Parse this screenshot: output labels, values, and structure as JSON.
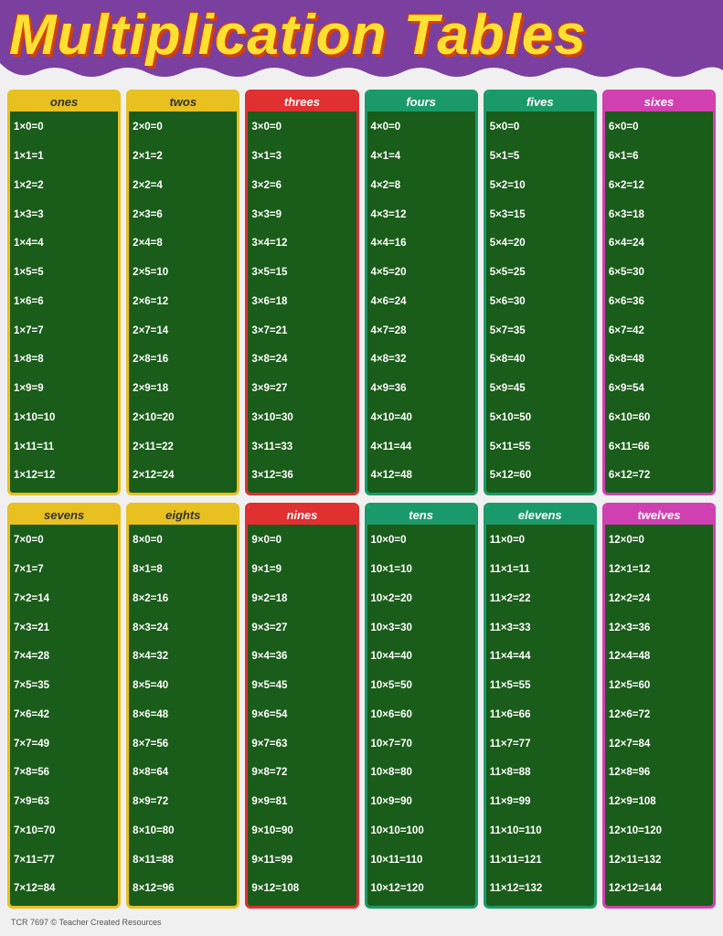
{
  "header": {
    "title": "Multiplication Tables"
  },
  "footer": "TCR 7697  © Teacher Created Resources",
  "tables": [
    {
      "id": "ones",
      "label": "ones",
      "cardClass": "card-ones",
      "multiplier": 1,
      "rows": [
        "1x0=0",
        "1x1=1",
        "1x2=2",
        "1x3=3",
        "1x4=4",
        "1x5=5",
        "1x6=6",
        "1x7=7",
        "1x8=8",
        "1x9=9",
        "1x10=10",
        "1x11=11",
        "1x12=12"
      ]
    },
    {
      "id": "twos",
      "label": "twos",
      "cardClass": "card-twos",
      "multiplier": 2,
      "rows": [
        "2x0=0",
        "2x1=2",
        "2x2=4",
        "2x3=6",
        "2x4=8",
        "2x5=10",
        "2x6=12",
        "2x7=14",
        "2x8=16",
        "2x9=18",
        "2x10=20",
        "2x11=22",
        "2x12=24"
      ]
    },
    {
      "id": "threes",
      "label": "threes",
      "cardClass": "card-threes",
      "multiplier": 3,
      "rows": [
        "3x0=0",
        "3x1=3",
        "3x2=6",
        "3x3=9",
        "3x4=12",
        "3x5=15",
        "3x6=18",
        "3x7=21",
        "3x8=24",
        "3x9=27",
        "3x10=30",
        "3x11=33",
        "3x12=36"
      ]
    },
    {
      "id": "fours",
      "label": "fours",
      "cardClass": "card-fours",
      "multiplier": 4,
      "rows": [
        "4x0=0",
        "4x1=4",
        "4x2=8",
        "4x3=12",
        "4x4=16",
        "4x5=20",
        "4x6=24",
        "4x7=28",
        "4x8=32",
        "4x9=36",
        "4x10=40",
        "4x11=44",
        "4x12=48"
      ]
    },
    {
      "id": "fives",
      "label": "fives",
      "cardClass": "card-fives",
      "multiplier": 5,
      "rows": [
        "5x0=0",
        "5x1=5",
        "5x2=10",
        "5x3=15",
        "5x4=20",
        "5x5=25",
        "5x6=30",
        "5x7=35",
        "5x8=40",
        "5x9=45",
        "5x10=50",
        "5x11=55",
        "5x12=60"
      ]
    },
    {
      "id": "sixes",
      "label": "sixes",
      "cardClass": "card-sixes",
      "multiplier": 6,
      "rows": [
        "6x0=0",
        "6x1=6",
        "6x2=12",
        "6x3=18",
        "6x4=24",
        "6x5=30",
        "6x6=36",
        "6x7=42",
        "6x8=48",
        "6x9=54",
        "6x10=60",
        "6x11=66",
        "6x12=72"
      ]
    },
    {
      "id": "sevens",
      "label": "sevens",
      "cardClass": "card-sevens",
      "multiplier": 7,
      "rows": [
        "7x0=0",
        "7x1=7",
        "7x2=14",
        "7x3=21",
        "7x4=28",
        "7x5=35",
        "7x6=42",
        "7x7=49",
        "7x8=56",
        "7x9=63",
        "7x10=70",
        "7x11=77",
        "7x12=84"
      ]
    },
    {
      "id": "eights",
      "label": "eights",
      "cardClass": "card-eights",
      "multiplier": 8,
      "rows": [
        "8x0=0",
        "8x1=8",
        "8x2=16",
        "8x3=24",
        "8x4=32",
        "8x5=40",
        "8x6=48",
        "8x7=56",
        "8x8=64",
        "8x9=72",
        "8x10=80",
        "8x11=88",
        "8x12=96"
      ]
    },
    {
      "id": "nines",
      "label": "nines",
      "cardClass": "card-nines",
      "multiplier": 9,
      "rows": [
        "9x0=0",
        "9x1=9",
        "9x2=18",
        "9x3=27",
        "9x4=36",
        "9x5=45",
        "9x6=54",
        "9x7=63",
        "9x8=72",
        "9x9=81",
        "9x10=90",
        "9x11=99",
        "9x12=108"
      ]
    },
    {
      "id": "tens",
      "label": "tens",
      "cardClass": "card-tens",
      "multiplier": 10,
      "rows": [
        "10x0=0",
        "10x1=10",
        "10x2=20",
        "10x3=30",
        "10x4=40",
        "10x5=50",
        "10x6=60",
        "10x7=70",
        "10x8=80",
        "10x9=90",
        "10x10=100",
        "10x11=110",
        "10x12=120"
      ]
    },
    {
      "id": "elevens",
      "label": "elevens",
      "cardClass": "card-elevens",
      "multiplier": 11,
      "rows": [
        "11x0=0",
        "11x1=11",
        "11x2=22",
        "11x3=33",
        "11x4=44",
        "11x5=55",
        "11x6=66",
        "11x7=77",
        "11x8=88",
        "11x9=99",
        "11x10=110",
        "11x11=121",
        "11x12=132"
      ]
    },
    {
      "id": "twelves",
      "label": "twelves",
      "cardClass": "card-twelves",
      "multiplier": 12,
      "rows": [
        "12x0=0",
        "12x1=12",
        "12x2=24",
        "12x3=36",
        "12x4=48",
        "12x5=60",
        "12x6=72",
        "12x7=84",
        "12x8=96",
        "12x9=108",
        "12x10=120",
        "12x11=132",
        "12x12=144"
      ]
    }
  ]
}
